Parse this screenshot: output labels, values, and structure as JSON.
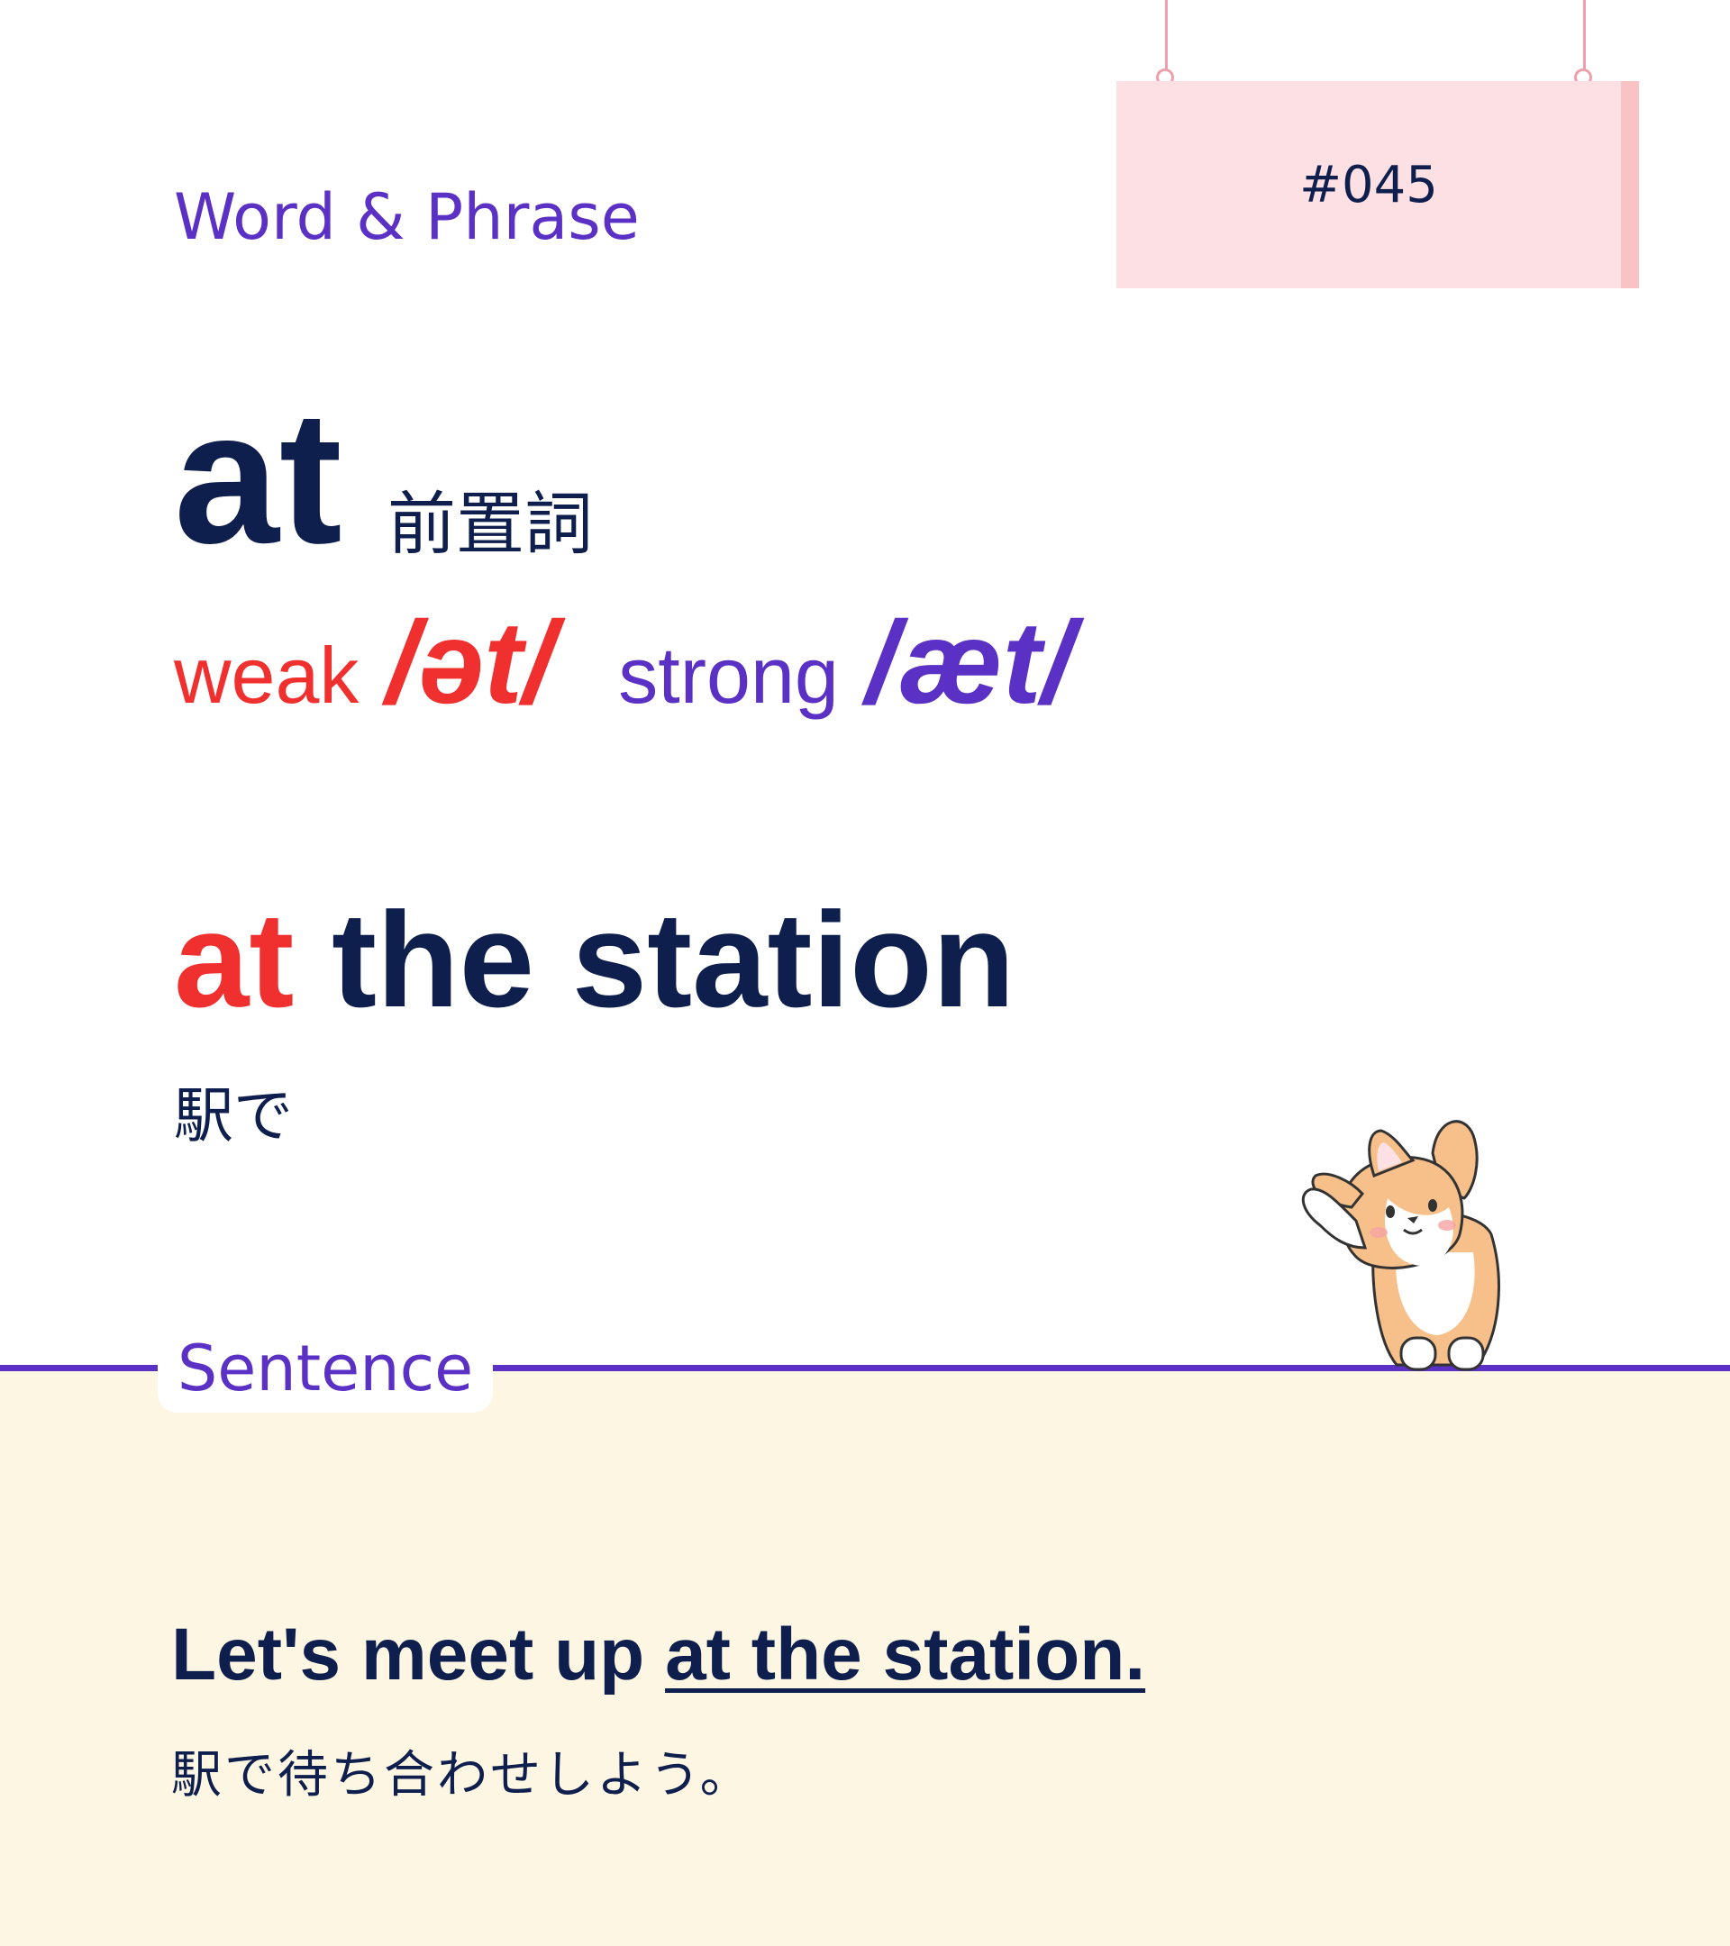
{
  "sign": {
    "number": "#045"
  },
  "header": {
    "section_label": "Word & Phrase"
  },
  "word": {
    "headword": "at",
    "part_of_speech": "前置詞",
    "weak_label": "weak",
    "weak_ipa": "/ət/",
    "strong_label": "strong",
    "strong_ipa": "/æt/"
  },
  "phrase": {
    "highlight": "at",
    "rest": " the station",
    "translation": "駅で"
  },
  "sentence_section": {
    "label": "Sentence",
    "prefix": "Let's meet up ",
    "underlined": "at the station.",
    "translation": "駅で待ち合わせしよう。"
  },
  "colors": {
    "accent_purple": "#5a31c4",
    "accent_red": "#f0302e",
    "navy_text": "#0f1f4d",
    "sign_pink": "#fde0e3",
    "sentence_bg": "#fdf6e3"
  }
}
